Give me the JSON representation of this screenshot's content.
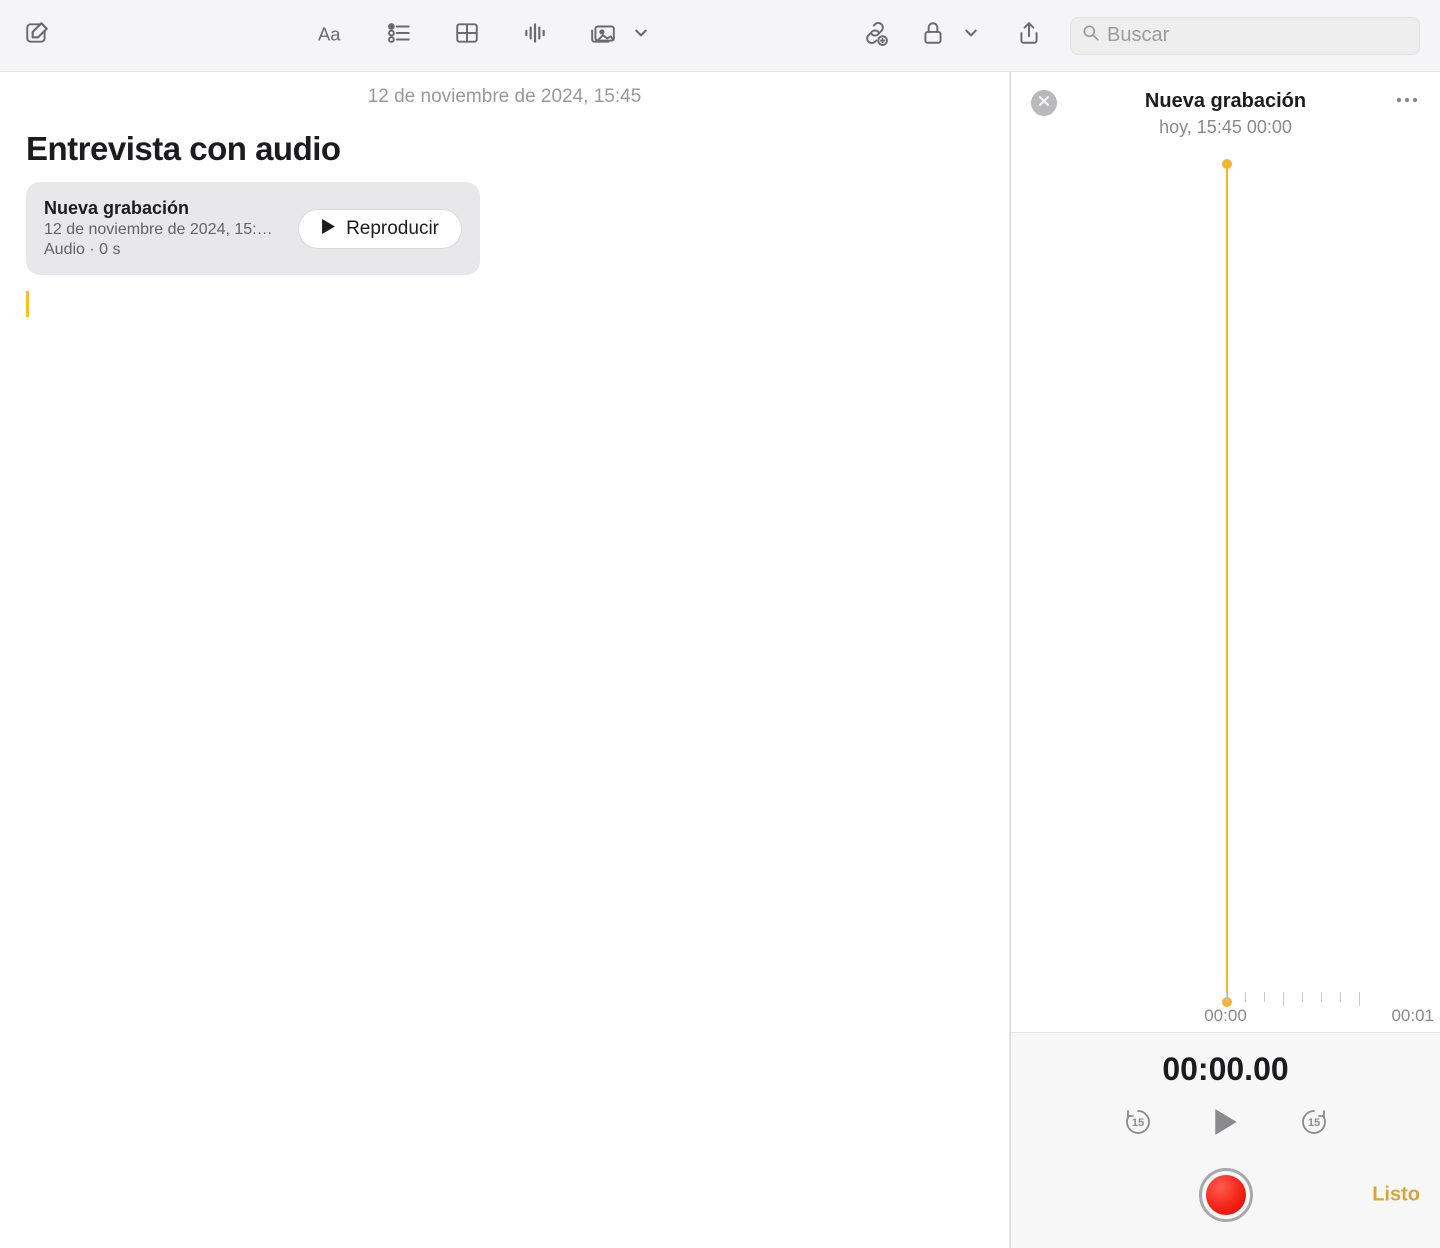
{
  "toolbar": {
    "search_placeholder": "Buscar"
  },
  "note": {
    "date": "12 de noviembre de 2024, 15:45",
    "title": "Entrevista con audio",
    "attachment": {
      "title": "Nueva grabación",
      "subtitle": "12 de noviembre de 2024, 15:…",
      "meta": "Audio · 0 s",
      "play_label": "Reproducir"
    }
  },
  "recorder": {
    "title": "Nueva grabación",
    "subtitle": "hoy, 15:45   00:00",
    "timeline": {
      "start": "00:00",
      "next": "00:01"
    },
    "elapsed": "00:00.00",
    "skip_back": "15",
    "skip_fwd": "15",
    "done_label": "Listo"
  }
}
